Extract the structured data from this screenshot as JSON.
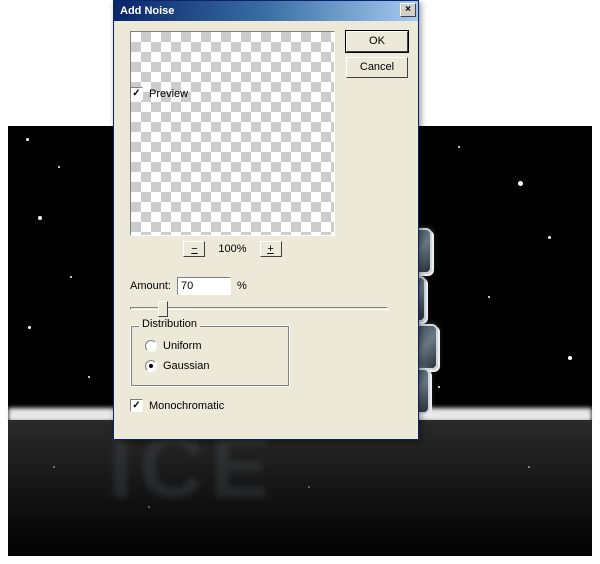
{
  "dialog": {
    "title": "Add Noise",
    "ok_label": "OK",
    "cancel_label": "Cancel",
    "preview_label": "Preview",
    "preview_checked": true,
    "zoom": {
      "pct": "100%",
      "minus": "−",
      "plus": "+"
    },
    "amount": {
      "label": "Amount:",
      "value": "70",
      "suffix": "%"
    },
    "distribution": {
      "legend": "Distribution",
      "uniform_label": "Uniform",
      "gaussian_label": "Gaussian",
      "selected": "gaussian"
    },
    "monochromatic": {
      "label": "Monochromatic",
      "checked": true
    },
    "close_glyph": "×",
    "check_glyph": "✓"
  }
}
